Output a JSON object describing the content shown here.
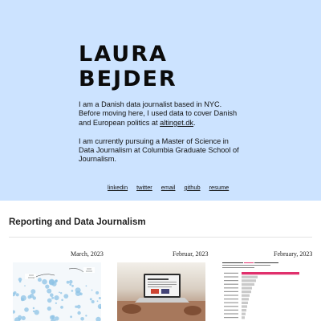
{
  "hero": {
    "name_line1": "LAURA",
    "name_line2": "BEJDER",
    "bio_p1_text": "I am a Danish data journalist based in NYC. Before moving here, I used data to cover Danish and European politics at ",
    "bio_p1_link": "altinget.dk",
    "bio_p1_end": ".",
    "bio_p2": "I am currently pursuing a Master of Science in Data Journalism at Columbia Graduate School of Journalism.",
    "links": [
      "linkedin",
      "twitter",
      "email",
      "github",
      "resume"
    ]
  },
  "section": {
    "title": "Reporting and Data Journalism"
  },
  "cards": [
    {
      "date": "March, 2023",
      "image": "scatter-bubbles-chart"
    },
    {
      "date": "Februar, 2023",
      "image": "laptop-photo"
    },
    {
      "date": "February, 2023",
      "image": "horizontal-bar-chart"
    }
  ],
  "colors": {
    "hero_bg": "#cce3ff",
    "accent_pink": "#e0306c"
  }
}
